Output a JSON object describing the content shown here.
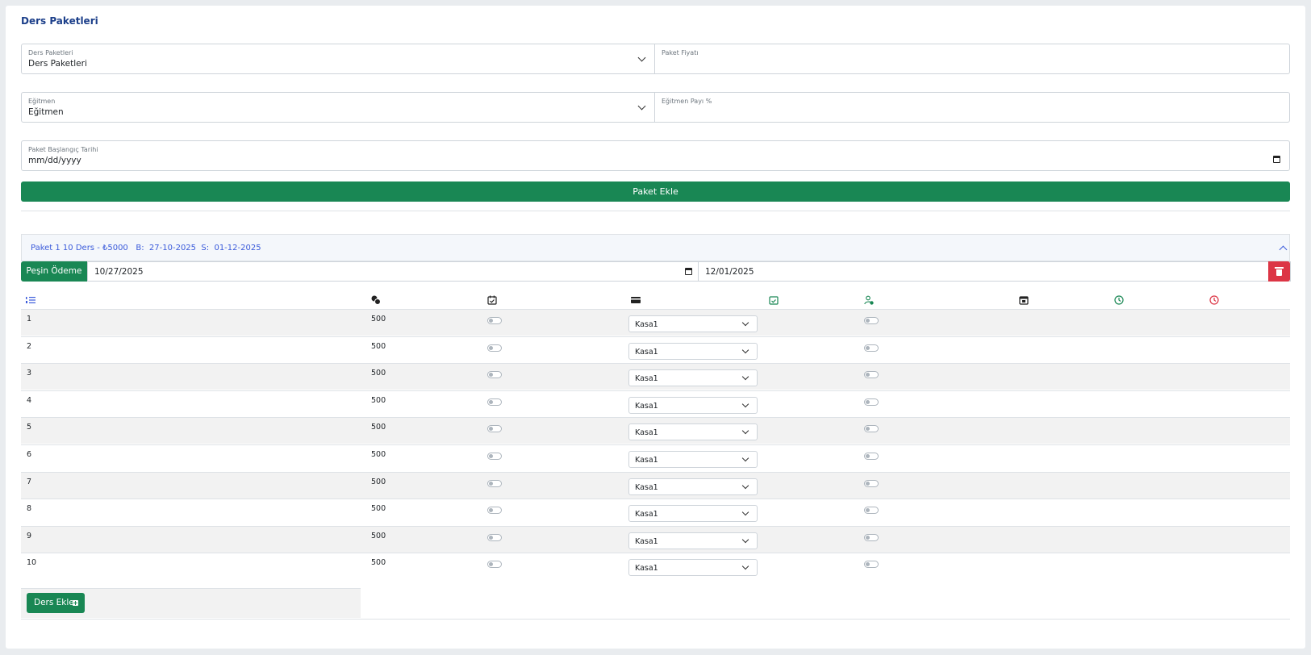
{
  "page": {
    "title": "Ders Paketleri"
  },
  "form": {
    "package": {
      "label": "Ders Paketleri",
      "value": "Ders Paketleri"
    },
    "price": {
      "label": "Paket Fiyatı",
      "value": ""
    },
    "instructor": {
      "label": "Eğitmen",
      "value": "Eğitmen"
    },
    "instructor_share": {
      "label": "Eğitmen Payı %",
      "value": ""
    },
    "start_date": {
      "label": "Paket Başlangıç Tarihi",
      "value": "mm/dd/yyyy"
    },
    "add_button": "Paket Ekle"
  },
  "package_panel": {
    "header": "Paket 1 10 Ders - ₺5000   B:  27-10-2025  S:  01-12-2025",
    "payment_button": "Peşin Ödeme",
    "start_date": "10/27/2025",
    "end_date": "12/01/2025",
    "columns": [
      "list-icon",
      "coins-icon",
      "calendar-check-icon",
      "credit-card-icon",
      "calendar-check-green-icon",
      "user-add-icon",
      "calendar-day-icon",
      "clock-green-icon",
      "clock-red-icon"
    ],
    "colors": {
      "green": "#198754",
      "red": "#dc3545",
      "blue": "#3b5bdb"
    },
    "rows": [
      {
        "no": "1",
        "price": "500",
        "cashbox": "Kasa1"
      },
      {
        "no": "2",
        "price": "500",
        "cashbox": "Kasa1"
      },
      {
        "no": "3",
        "price": "500",
        "cashbox": "Kasa1"
      },
      {
        "no": "4",
        "price": "500",
        "cashbox": "Kasa1"
      },
      {
        "no": "5",
        "price": "500",
        "cashbox": "Kasa1"
      },
      {
        "no": "6",
        "price": "500",
        "cashbox": "Kasa1"
      },
      {
        "no": "7",
        "price": "500",
        "cashbox": "Kasa1"
      },
      {
        "no": "8",
        "price": "500",
        "cashbox": "Kasa1"
      },
      {
        "no": "9",
        "price": "500",
        "cashbox": "Kasa1"
      },
      {
        "no": "10",
        "price": "500",
        "cashbox": "Kasa1"
      }
    ],
    "add_lesson_button": "Ders Ekle"
  }
}
